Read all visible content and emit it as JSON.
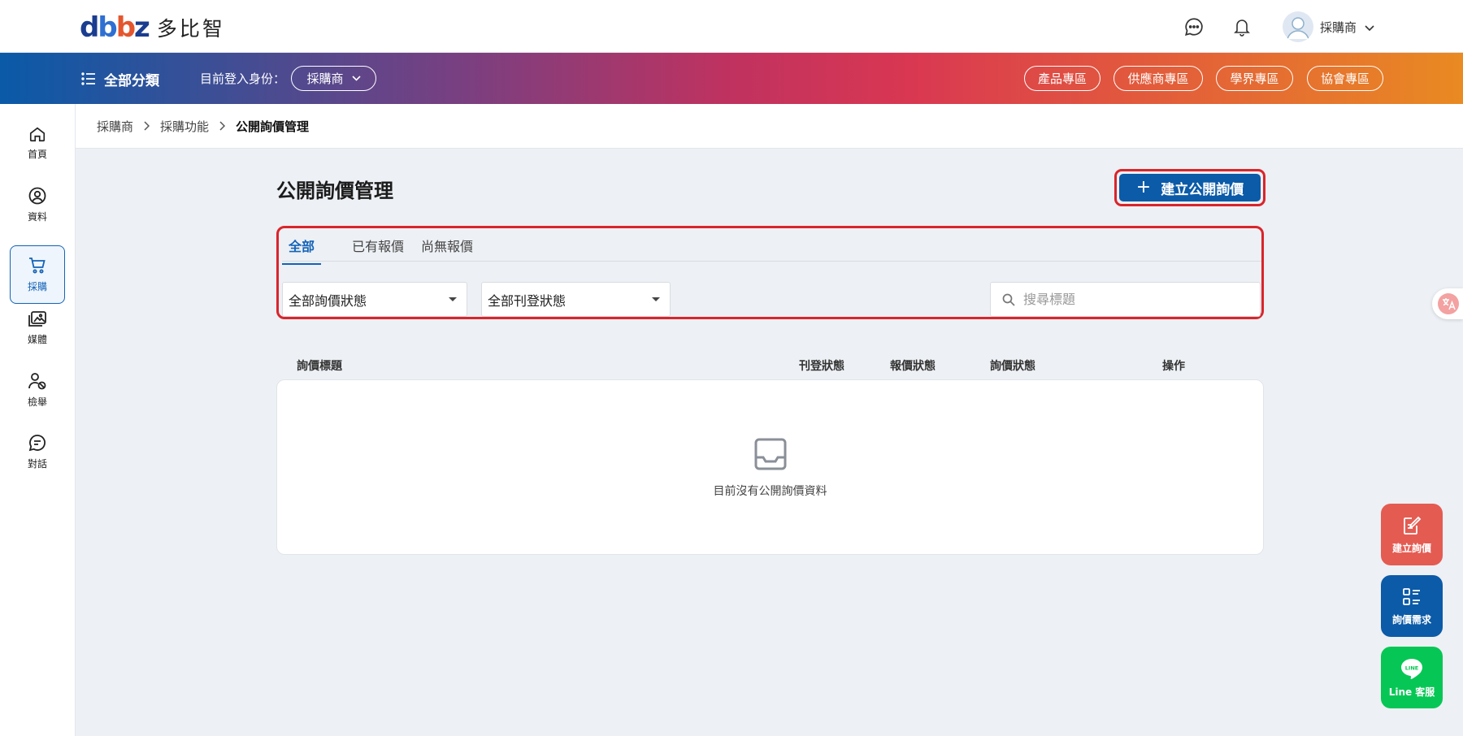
{
  "brand": {
    "logo_text": "多比智"
  },
  "header": {
    "user_name": "採購商"
  },
  "navbar": {
    "all_categories": "全部分類",
    "identity_label": "目前登入身份：",
    "identity_value": "採購商",
    "zones": [
      "產品專區",
      "供應商專區",
      "學界專區",
      "協會專區"
    ]
  },
  "sidebar": {
    "items": [
      {
        "label": "首頁",
        "icon": "home-icon"
      },
      {
        "label": "資料",
        "icon": "user-circle-icon"
      },
      {
        "label": "採購",
        "icon": "cart-icon",
        "active": true
      },
      {
        "label": "媒體",
        "icon": "media-icon"
      },
      {
        "label": "檢舉",
        "icon": "report-user-icon"
      },
      {
        "label": "對話",
        "icon": "chat-icon"
      }
    ]
  },
  "breadcrumb": [
    "採購商",
    "採購功能",
    "公開詢價管理"
  ],
  "page": {
    "title": "公開詢價管理",
    "create_label": "建立公開詢價",
    "tabs": [
      "全部",
      "已有報價",
      "尚無報價"
    ],
    "filters": {
      "inquiry_status": "全部詢價狀態",
      "publish_status": "全部刊登狀態"
    },
    "search_placeholder": "搜尋標題",
    "columns": [
      "詢價標題",
      "刊登狀態",
      "報價狀態",
      "詢價狀態",
      "操作"
    ],
    "empty_text": "目前沒有公開詢價資料"
  },
  "fabs": {
    "create_inquiry": "建立詢價",
    "inquiry_demand": "詢價需求",
    "line_service": "Line 客服",
    "line_logo": "LINE"
  },
  "colors": {
    "primary": "#0b5ba8",
    "highlight": "#d9252b",
    "fab_red": "#e45b52",
    "fab_blue": "#0b5ba8",
    "fab_green": "#06c755"
  }
}
